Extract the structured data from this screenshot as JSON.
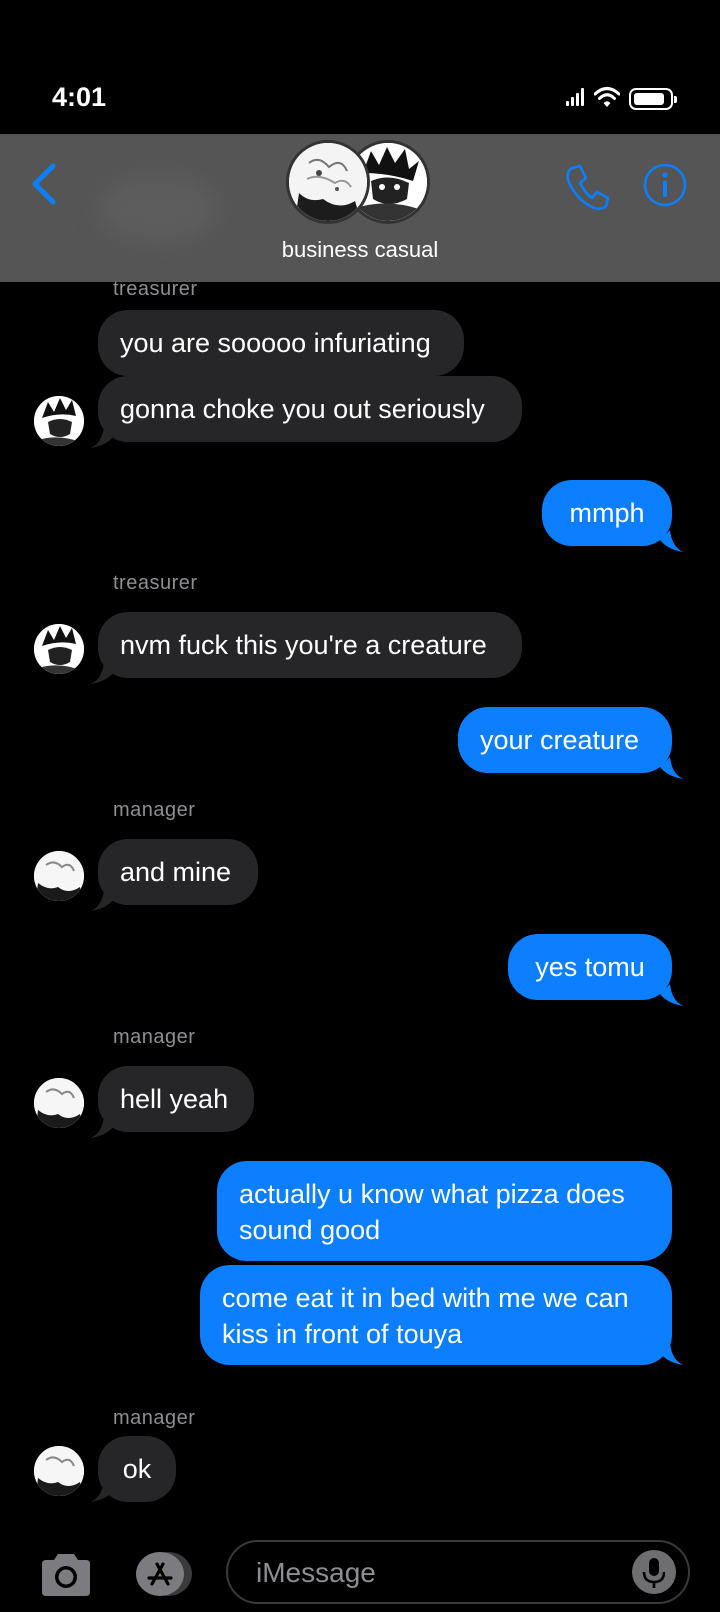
{
  "status_bar": {
    "time": "4:01"
  },
  "header": {
    "group_name": "business casual",
    "accent": "#0b7fff"
  },
  "messages": [
    {
      "sender": "treasurer",
      "text": "you are sooooo infuriating"
    },
    {
      "text": "gonna choke you out seriously"
    },
    {
      "text": "mmph"
    },
    {
      "sender": "treasurer",
      "text": "nvm fuck this you're a creature"
    },
    {
      "text": "your creature"
    },
    {
      "sender": "manager",
      "text": "and mine"
    },
    {
      "text": "yes tomu"
    },
    {
      "sender": "manager",
      "text": "hell yeah"
    },
    {
      "text": "actually u know what pizza does sound good"
    },
    {
      "text": "come eat it in bed with me we can kiss in front of touya"
    },
    {
      "sender": "manager",
      "text": "ok"
    }
  ],
  "input": {
    "placeholder": "iMessage"
  },
  "colors": {
    "background": "#000000",
    "incoming_bubble": "#262628",
    "outgoing_bubble": "#0b7fff",
    "header": "#555555"
  }
}
